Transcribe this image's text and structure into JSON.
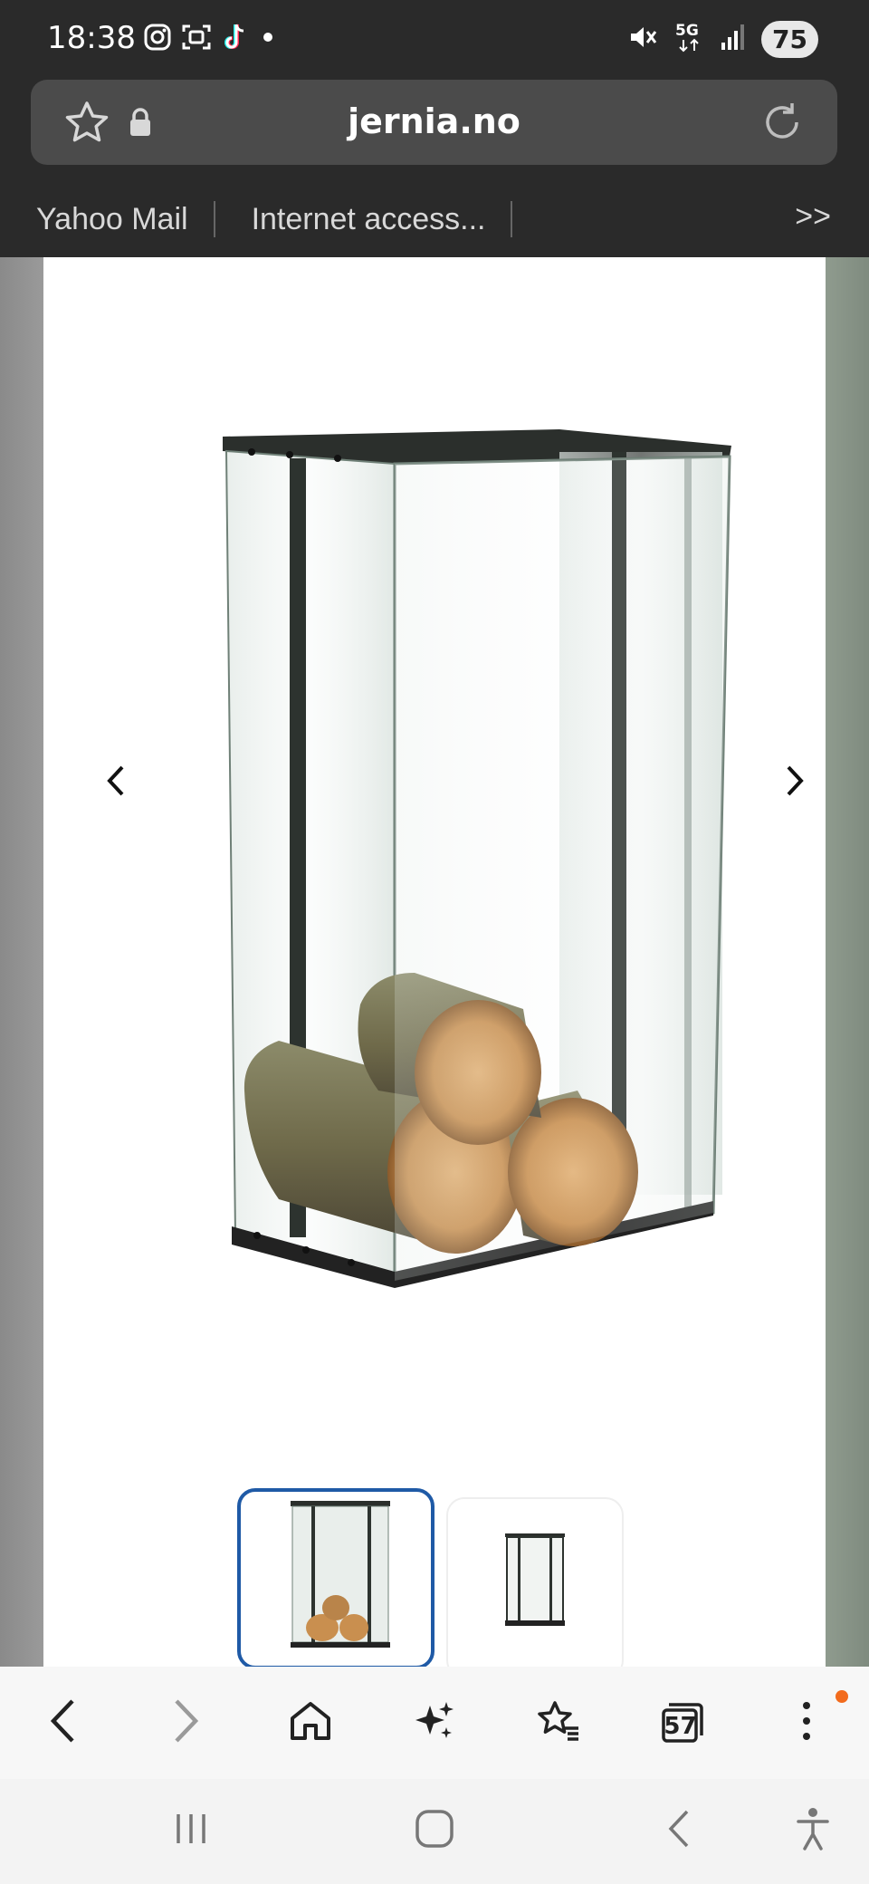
{
  "status_bar": {
    "time": "18:38",
    "left_icons": [
      "instagram-icon",
      "scan-icon",
      "tiktok-icon",
      "dot-icon"
    ],
    "right_icons": [
      "mute-icon",
      "5g-icon",
      "signal-icon"
    ],
    "network": "5G",
    "battery": "75"
  },
  "browser": {
    "url": "jernia.no",
    "bookmarks": [
      "Yahoo Mail",
      "Internet access..."
    ],
    "more_label": ">>",
    "tab_count": "57"
  },
  "product": {
    "image": "glass-firewood-rack-image",
    "thumbnails": [
      "thumbnail-1",
      "thumbnail-2"
    ],
    "selected_thumbnail": 1
  },
  "colors": {
    "chrome_dark": "#2a2a2a",
    "url_bar": "#4b4b4b",
    "thumb_selected_border": "#1f5aa6",
    "notification_dot": "#f26b1d"
  }
}
